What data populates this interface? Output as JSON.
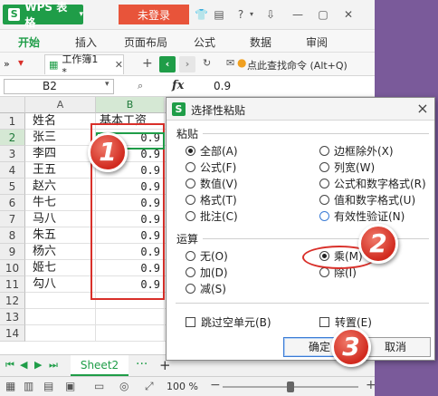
{
  "titlebar": {
    "app_name": "WPS 表格",
    "login": "未登录"
  },
  "menu": [
    "开始",
    "插入",
    "页面布局",
    "公式",
    "数据",
    "审阅"
  ],
  "toolbar": {
    "doc_tab": "工作簿1 *",
    "search_cmd": "点此查找命令 (Alt+Q)"
  },
  "formula": {
    "cell_ref": "B2",
    "fx": "fx",
    "value": "0.9"
  },
  "columns": [
    "A",
    "B"
  ],
  "rows": [
    {
      "num": "1",
      "a": "姓名",
      "b": "基本工资"
    },
    {
      "num": "2",
      "a": "张三",
      "b": "0.9"
    },
    {
      "num": "3",
      "a": "李四",
      "b": "0.9"
    },
    {
      "num": "4",
      "a": "王五",
      "b": "0.9"
    },
    {
      "num": "5",
      "a": "赵六",
      "b": "0.9"
    },
    {
      "num": "6",
      "a": "牛七",
      "b": "0.9"
    },
    {
      "num": "7",
      "a": "马八",
      "b": "0.9"
    },
    {
      "num": "8",
      "a": "朱五",
      "b": "0.9"
    },
    {
      "num": "9",
      "a": "杨六",
      "b": "0.9"
    },
    {
      "num": "10",
      "a": "姬七",
      "b": "0.9"
    },
    {
      "num": "11",
      "a": "勾八",
      "b": "0.9"
    },
    {
      "num": "12",
      "a": "",
      "b": ""
    },
    {
      "num": "13",
      "a": "",
      "b": ""
    },
    {
      "num": "14",
      "a": "",
      "b": ""
    }
  ],
  "sheet_tab": "Sheet2",
  "status": {
    "zoom": "100 %"
  },
  "dialog": {
    "title": "选择性粘贴",
    "paste_group": "粘贴",
    "paste_left": [
      {
        "label": "全部(A)",
        "selected": true
      },
      {
        "label": "公式(F)",
        "selected": false
      },
      {
        "label": "数值(V)",
        "selected": false
      },
      {
        "label": "格式(T)",
        "selected": false
      },
      {
        "label": "批注(C)",
        "selected": false
      }
    ],
    "paste_right": [
      {
        "label": "边框除外(X)",
        "selected": false
      },
      {
        "label": "列宽(W)",
        "selected": false
      },
      {
        "label": "公式和数字格式(R)",
        "selected": false
      },
      {
        "label": "值和数字格式(U)",
        "selected": false
      },
      {
        "label": "有效性验证(N)",
        "selected": false
      }
    ],
    "op_group": "运算",
    "op_left": [
      {
        "label": "无(O)",
        "selected": false
      },
      {
        "label": "加(D)",
        "selected": false
      },
      {
        "label": "减(S)",
        "selected": false
      }
    ],
    "op_right": [
      {
        "label": "乘(M)",
        "selected": true
      },
      {
        "label": "除(I)",
        "selected": false
      }
    ],
    "skip_blanks": "跳过空单元(B)",
    "transpose": "转置(E)",
    "ok": "确定",
    "cancel": "取消"
  },
  "badges": [
    "1",
    "2",
    "3"
  ],
  "colors": {
    "accent": "#1f9d48",
    "highlight": "#d9302a",
    "login": "#e8543a"
  }
}
